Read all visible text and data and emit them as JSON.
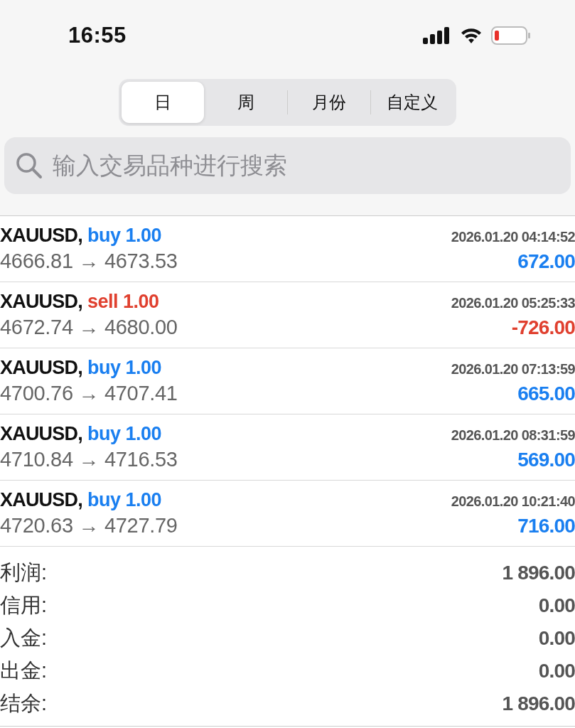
{
  "status_bar": {
    "time": "16:55"
  },
  "tabs": [
    {
      "label": "日",
      "selected": true
    },
    {
      "label": "周",
      "selected": false
    },
    {
      "label": "月份",
      "selected": false
    },
    {
      "label": "自定义",
      "selected": false
    }
  ],
  "search": {
    "placeholder": "输入交易品种进行搜索"
  },
  "trades": [
    {
      "symbol": "XAUUSD,",
      "kind": "buy",
      "order": "buy 1.00",
      "time": "2026.01.20 04:14:52",
      "prices": "4666.81 → 4673.53",
      "profit": "672.00"
    },
    {
      "symbol": "XAUUSD,",
      "kind": "sell",
      "order": "sell 1.00",
      "time": "2026.01.20 05:25:33",
      "prices": "4672.74 → 4680.00",
      "profit": "-726.00"
    },
    {
      "symbol": "XAUUSD,",
      "kind": "buy",
      "order": "buy 1.00",
      "time": "2026.01.20 07:13:59",
      "prices": "4700.76 → 4707.41",
      "profit": "665.00"
    },
    {
      "symbol": "XAUUSD,",
      "kind": "buy",
      "order": "buy 1.00",
      "time": "2026.01.20 08:31:59",
      "prices": "4710.84 → 4716.53",
      "profit": "569.00"
    },
    {
      "symbol": "XAUUSD,",
      "kind": "buy",
      "order": "buy 1.00",
      "time": "2026.01.20 10:21:40",
      "prices": "4720.63 → 4727.79",
      "profit": "716.00"
    }
  ],
  "summary": [
    {
      "label": "利润:",
      "value": "1 896.00"
    },
    {
      "label": "信用:",
      "value": "0.00"
    },
    {
      "label": "入金:",
      "value": "0.00"
    },
    {
      "label": "出金:",
      "value": "0.00"
    },
    {
      "label": "结余:",
      "value": "1 896.00"
    }
  ]
}
